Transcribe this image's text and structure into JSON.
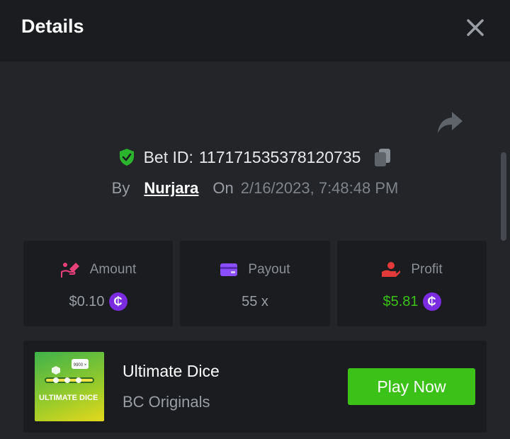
{
  "header": {
    "title": "Details"
  },
  "bet": {
    "label": "Bet ID:",
    "id": "117171535378120735",
    "by_label": "By",
    "user": "Nurjara",
    "on_label": "On",
    "datetime": "2/16/2023, 7:48:48 PM"
  },
  "stats": {
    "amount": {
      "label": "Amount",
      "value": "$0.10"
    },
    "payout": {
      "label": "Payout",
      "value": "55 x"
    },
    "profit": {
      "label": "Profit",
      "value": "$5.81"
    }
  },
  "currency": {
    "symbol": "₵",
    "color": "#7b2be0"
  },
  "game": {
    "name": "Ultimate Dice",
    "provider": "BC Originals",
    "thumbnail_text": "ULTIMATE DICE",
    "thumbnail_badge": "9900 ×",
    "play_label": "Play Now"
  },
  "colors": {
    "accent_green": "#3bc117",
    "shield_green": "#2bb52e",
    "amount_icon": "#e8417a",
    "payout_icon": "#8a4dff",
    "profit_icon": "#e03a3a"
  },
  "icons": {
    "close": "close-icon",
    "share": "share-icon",
    "shield": "shield-check-icon",
    "copy": "copy-icon",
    "amount": "hand-coin-icon",
    "payout": "wallet-icon",
    "profit": "hand-money-icon"
  }
}
